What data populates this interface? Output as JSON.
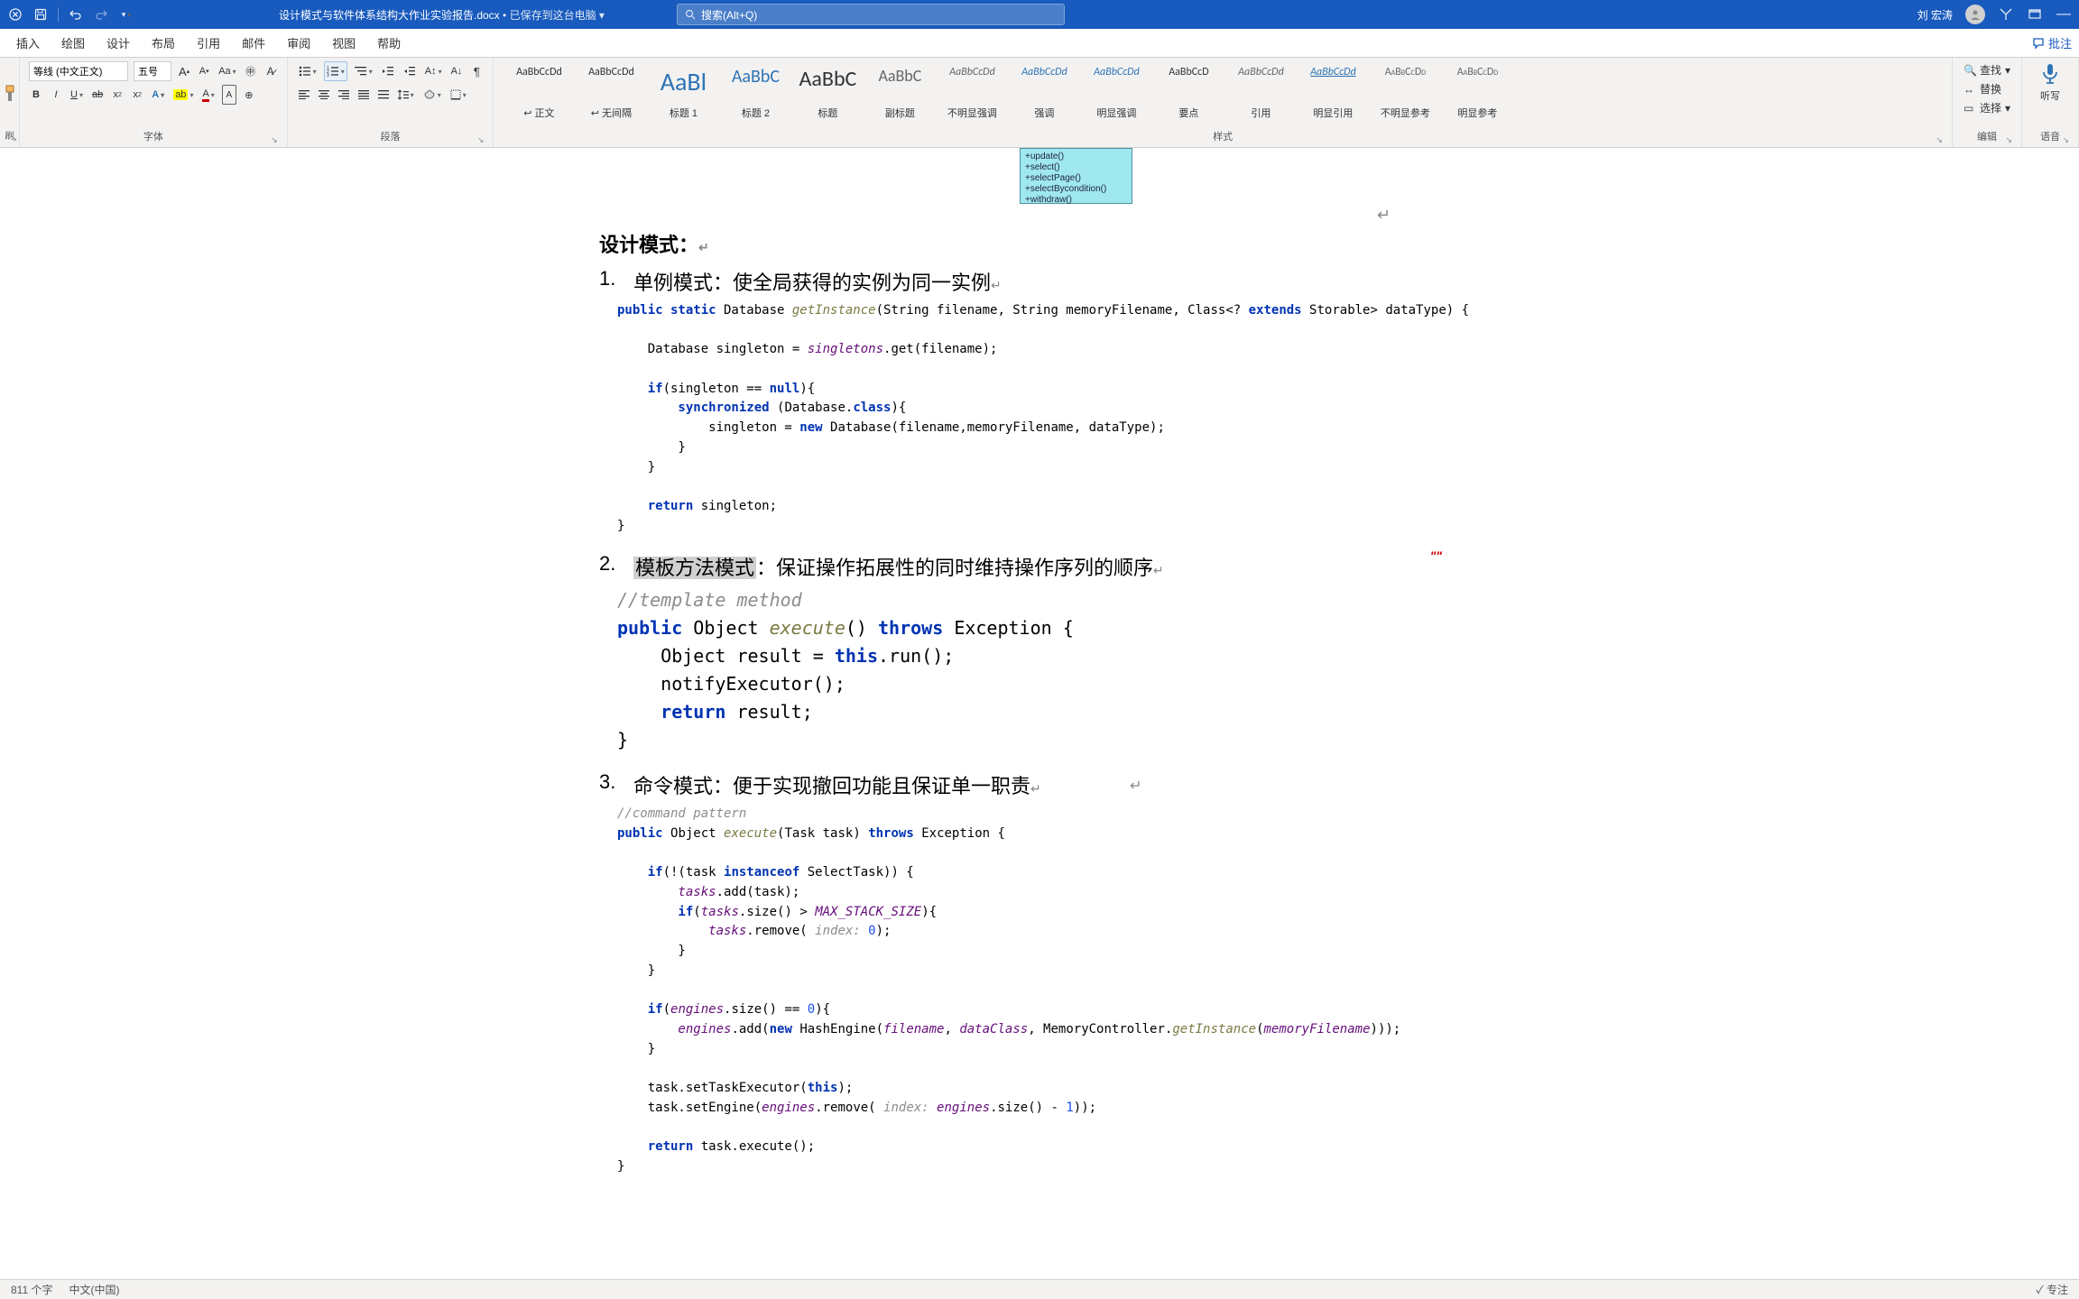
{
  "titleBar": {
    "docTitle": "设计模式与软件体系结构大作业实验报告.docx",
    "savedStatus": "已保存到这台电脑",
    "searchPlaceholder": "搜索(Alt+Q)",
    "userName": "刘 宏涛"
  },
  "tabs": {
    "items": [
      "插入",
      "绘图",
      "设计",
      "布局",
      "引用",
      "邮件",
      "审阅",
      "视图",
      "帮助"
    ],
    "coauthorLabel": "批注"
  },
  "ribbon": {
    "clipboardLabel": "刷",
    "font": {
      "fontName": "等线 (中文正文)",
      "fontSize": "五号",
      "groupLabel": "字体"
    },
    "paragraph": {
      "groupLabel": "段落"
    },
    "styles": {
      "items": [
        {
          "preview": "AaBbCcDd",
          "name": "↩ 正文",
          "cls": ""
        },
        {
          "preview": "AaBbCcDd",
          "name": "↩ 无间隔",
          "cls": ""
        },
        {
          "preview": "AaBl",
          "name": "标题 1",
          "cls": "big"
        },
        {
          "preview": "AaBbC",
          "name": "标题 2",
          "cls": "h2"
        },
        {
          "preview": "AaBbC",
          "name": "标题",
          "cls": "tt"
        },
        {
          "preview": "AaBbC",
          "name": "副标题",
          "cls": "st"
        },
        {
          "preview": "AaBbCcDd",
          "name": "不明显强调",
          "cls": "italic"
        },
        {
          "preview": "AaBbCcDd",
          "name": "强调",
          "cls": "italic blue"
        },
        {
          "preview": "AaBbCcDd",
          "name": "明显强调",
          "cls": "italic blue"
        },
        {
          "preview": "AaBbCcD",
          "name": "要点",
          "cls": ""
        },
        {
          "preview": "AaBbCcDd",
          "name": "引用",
          "cls": "italic"
        },
        {
          "preview": "AaBbCcDd",
          "name": "明显引用",
          "cls": "italic blue underline"
        },
        {
          "preview": "AaBbCcDd",
          "name": "不明显参考",
          "cls": "smallcaps"
        },
        {
          "preview": "AaBbCcDd",
          "name": "明显参考",
          "cls": "smallcaps blue"
        }
      ],
      "groupLabel": "样式"
    },
    "editing": {
      "find": "查找",
      "replace": "替换",
      "select": "选择",
      "groupLabel": "编辑"
    },
    "dictate": {
      "label": "听写",
      "groupLabel": "语音"
    }
  },
  "document": {
    "umlLines": [
      "+update()",
      "+select()",
      "+selectPage()",
      "+selectBycondition()",
      "+withdraw()"
    ],
    "headingDesign": "设计模式：",
    "item1": {
      "num": "1.",
      "text": "单例模式：使全局获得的实例为同一实例"
    },
    "code1_line1_a": "public static",
    "code1_line1_b": " Database ",
    "code1_line1_c": "getInstance",
    "code1_line1_d": "(String filename, String memoryFilename, Class<",
    "code1_line1_e": "? ",
    "code1_line1_f": "extends",
    "code1_line1_g": " Storable> dataType) {",
    "code1_line2_a": "    Database singleton = ",
    "code1_line2_b": "singletons",
    "code1_line2_c": ".get(filename);",
    "code1_line3_a": "    if",
    "code1_line3_b": "(singleton == ",
    "code1_line3_c": "null",
    "code1_line3_d": "){",
    "code1_line4_a": "        synchronized ",
    "code1_line4_b": "(Database.",
    "code1_line4_c": "class",
    "code1_line4_d": "){",
    "code1_line5_a": "            singleton = ",
    "code1_line5_b": "new ",
    "code1_line5_c": "Database(filename,memoryFilename, dataType);",
    "code1_line6": "        }",
    "code1_line7": "    }",
    "code1_line8_a": "    return ",
    "code1_line8_b": "singleton;",
    "code1_line9": "}",
    "item2": {
      "num": "2.",
      "hl": "模板方法模式",
      "text": "：保证操作拓展性的同时维持操作序列的顺序"
    },
    "code2_line1": "//template method",
    "code2_line2_a": "public ",
    "code2_line2_b": "Object ",
    "code2_line2_c": "execute",
    "code2_line2_d": "() ",
    "code2_line2_e": "throws ",
    "code2_line2_f": "Exception {",
    "code2_line3_a": "    Object result = ",
    "code2_line3_b": "this",
    "code2_line3_c": ".run();",
    "code2_line4": "    notifyExecutor();",
    "code2_line5_a": "    return ",
    "code2_line5_b": "result;",
    "code2_line6": "}",
    "item3": {
      "num": "3.",
      "text": "命令模式：便于实现撤回功能且保证单一职责"
    },
    "code3_line1": "//command pattern",
    "code3_line2_a": "public ",
    "code3_line2_b": "Object ",
    "code3_line2_c": "execute",
    "code3_line2_d": "(Task task) ",
    "code3_line2_e": "throws ",
    "code3_line2_f": "Exception {",
    "code3_line3_a": "    if",
    "code3_line3_b": "(!(task ",
    "code3_line3_c": "instanceof ",
    "code3_line3_d": "SelectTask)) {",
    "code3_line4_a": "        tasks",
    "code3_line4_b": ".add(task);",
    "code3_line5_a": "        if",
    "code3_line5_b": "(",
    "code3_line5_c": "tasks",
    "code3_line5_d": ".size() > ",
    "code3_line5_e": "MAX_STACK_SIZE",
    "code3_line5_f": "){",
    "code3_line6_a": "            tasks",
    "code3_line6_b": ".remove( ",
    "code3_line6_c": "index: ",
    "code3_line6_d": "0",
    "code3_line6_e": ");",
    "code3_line7": "        }",
    "code3_line8": "    }",
    "code3_line9_a": "    if",
    "code3_line9_b": "(",
    "code3_line9_c": "engines",
    "code3_line9_d": ".size() == ",
    "code3_line9_e": "0",
    "code3_line9_f": "){",
    "code3_line10_a": "        engines",
    "code3_line10_b": ".add(",
    "code3_line10_c": "new ",
    "code3_line10_d": "HashEngine(",
    "code3_line10_e": "filename",
    "code3_line10_f": ", ",
    "code3_line10_g": "dataClass",
    "code3_line10_h": ", MemoryController.",
    "code3_line10_i": "getInstance",
    "code3_line10_j": "(",
    "code3_line10_k": "memoryFilename",
    "code3_line10_l": ")));",
    "code3_line11": "    }",
    "code3_line12_a": "    task.setTaskExecutor(",
    "code3_line12_b": "this",
    "code3_line12_c": ");",
    "code3_line13_a": "    task.setEngine(",
    "code3_line13_b": "engines",
    "code3_line13_c": ".remove( ",
    "code3_line13_d": "index: ",
    "code3_line13_e": "engines",
    "code3_line13_f": ".size() - ",
    "code3_line13_g": "1",
    "code3_line13_h": "));",
    "code3_line14_a": "    return ",
    "code3_line14_b": "task.execute();",
    "code3_line15": "}"
  },
  "statusBar": {
    "wordCount": "811 个字",
    "language": "中文(中国)",
    "focus": "专注"
  }
}
